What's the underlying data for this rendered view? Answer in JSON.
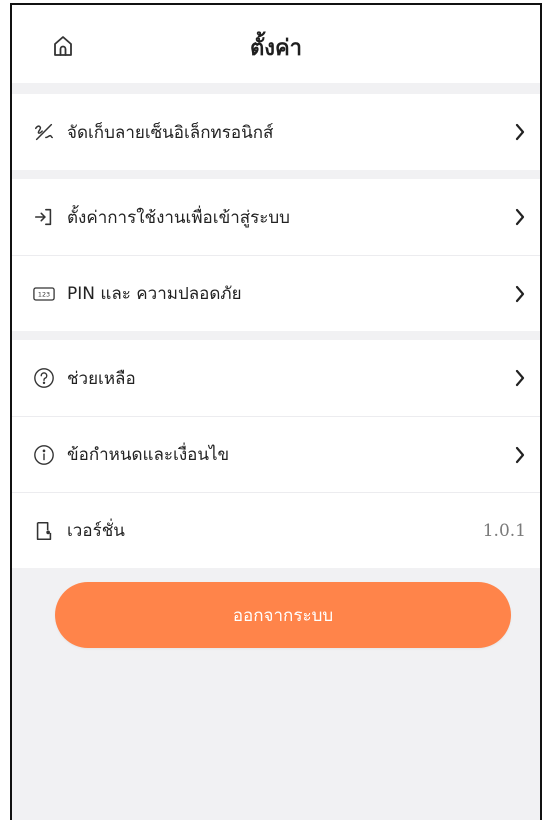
{
  "header": {
    "title": "ตั้งค่า",
    "home_icon": "home-icon"
  },
  "sections": [
    {
      "items": [
        {
          "label": "จัดเก็บลายเซ็นอิเล็กทรอนิกส์",
          "icon": "signature-icon"
        }
      ]
    },
    {
      "items": [
        {
          "label": "ตั้งค่าการใช้งานเพื่อเข้าสู่ระบบ",
          "icon": "login-icon"
        },
        {
          "label": "PIN และ ความปลอดภัย",
          "icon": "pin-icon"
        }
      ]
    },
    {
      "items": [
        {
          "label": "ช่วยเหลือ",
          "icon": "help-icon"
        },
        {
          "label": "ข้อกำหนดและเงื่อนไข",
          "icon": "info-icon"
        },
        {
          "label": "เวอร์ชั่น",
          "icon": "version-icon",
          "value": "1.0.1"
        }
      ]
    }
  ],
  "logout": {
    "label": "ออกจากระบบ",
    "color": "#ff844a"
  },
  "colors": {
    "background": "#f1f1f3",
    "card": "#ffffff",
    "accent": "#ff844a"
  }
}
